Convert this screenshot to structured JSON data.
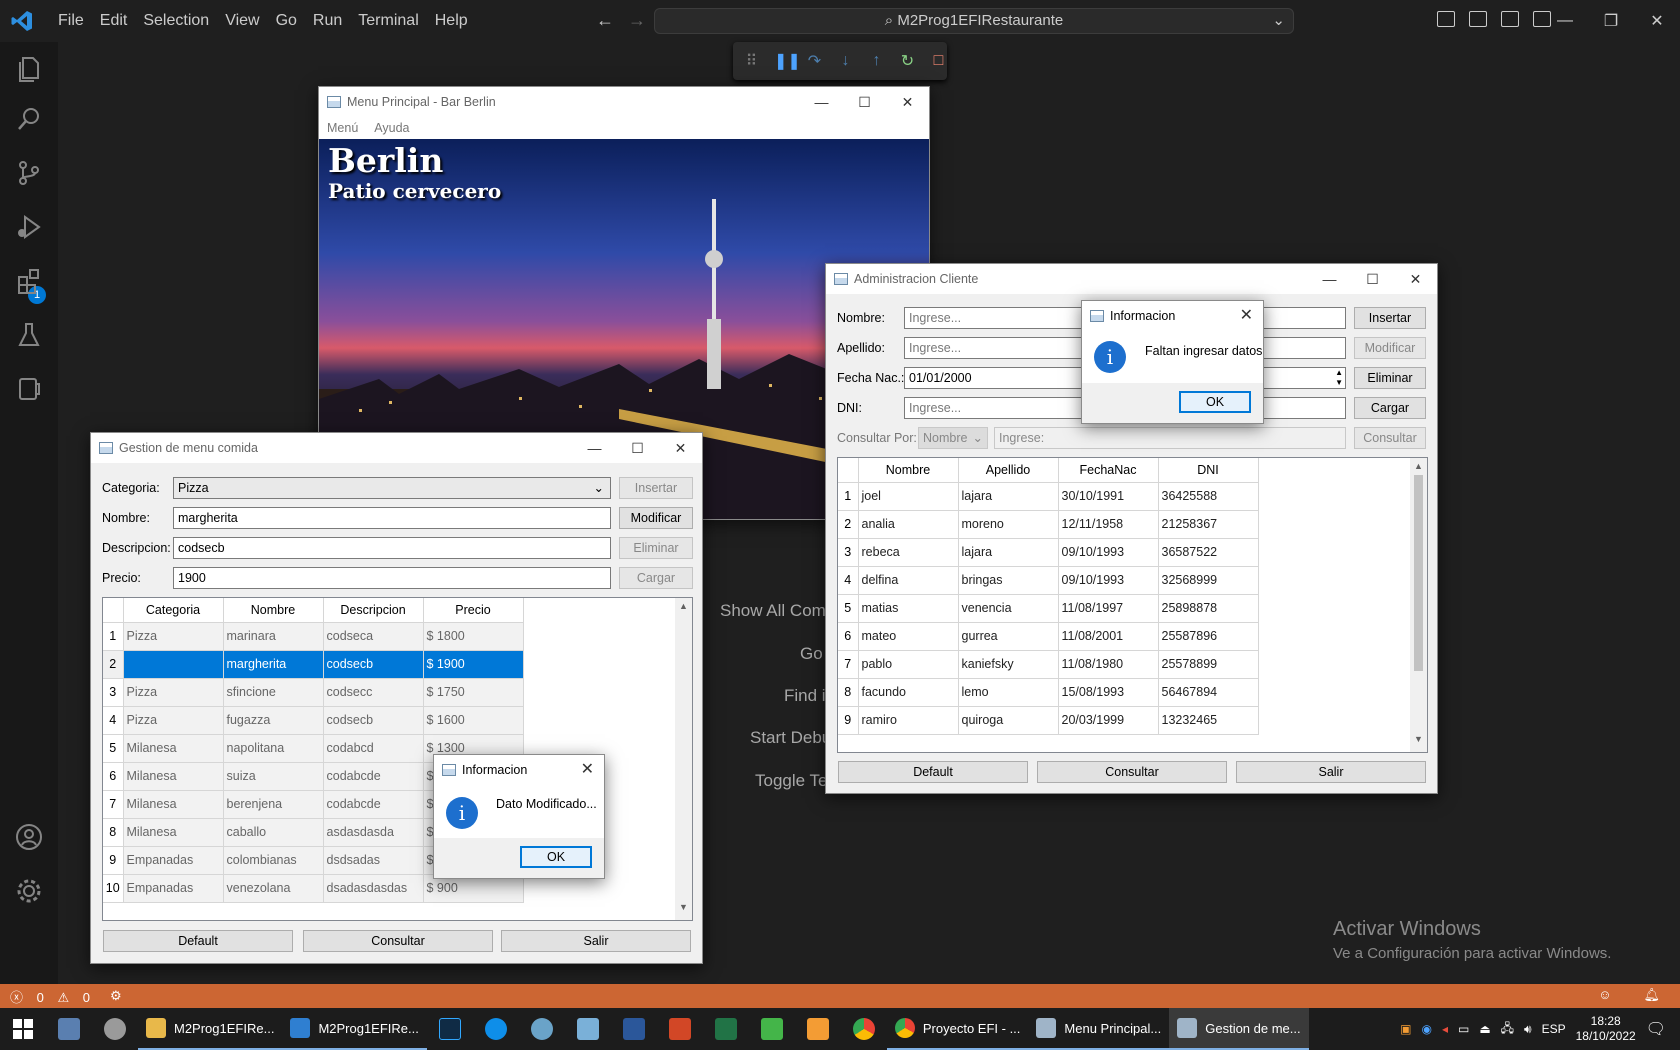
{
  "vscode": {
    "menu": [
      "File",
      "Edit",
      "Selection",
      "View",
      "Go",
      "Run",
      "Terminal",
      "Help"
    ],
    "command_center": "M2Prog1EFIRestaurante",
    "debug_badge": "1",
    "welcome_hints": [
      "Show All Com",
      "Go",
      "Find i",
      "Start Debu",
      "Toggle Te"
    ],
    "activate_title": "Activar Windows",
    "activate_sub": "Ve a Configuración para activar Windows.",
    "status_errors": "0",
    "status_warnings": "0"
  },
  "menu_principal": {
    "title": "Menu Principal - Bar Berlin",
    "menu_items": [
      "Menú",
      "Ayuda"
    ],
    "banner_title": "Berlin",
    "banner_subtitle": "Patio cervecero"
  },
  "gestion_menu": {
    "title": "Gestion de menu comida",
    "labels": {
      "categoria": "Categoria:",
      "nombre": "Nombre:",
      "descripcion": "Descripcion:",
      "precio": "Precio:"
    },
    "values": {
      "categoria": "Pizza",
      "nombre": "margherita",
      "descripcion": "codsecb",
      "precio": "1900"
    },
    "buttons": {
      "insertar": "Insertar",
      "modificar": "Modificar",
      "eliminar": "Eliminar",
      "cargar": "Cargar",
      "default": "Default",
      "consultar": "Consultar",
      "salir": "Salir"
    },
    "columns": [
      "Categoria",
      "Nombre",
      "Descripcion",
      "Precio"
    ],
    "rows": [
      {
        "n": "1",
        "cat": "Pizza",
        "nom": "marinara",
        "desc": "codseca",
        "precio": "$ 1800"
      },
      {
        "n": "2",
        "cat": "",
        "nom": "margherita",
        "desc": "codsecb",
        "precio": "$ 1900"
      },
      {
        "n": "3",
        "cat": "Pizza",
        "nom": "sfincione",
        "desc": "codsecc",
        "precio": "$ 1750"
      },
      {
        "n": "4",
        "cat": "Pizza",
        "nom": "fugazza",
        "desc": "codsecb",
        "precio": "$ 1600"
      },
      {
        "n": "5",
        "cat": "Milanesa",
        "nom": "napolitana",
        "desc": "codabcd",
        "precio": "$ 1300"
      },
      {
        "n": "6",
        "cat": "Milanesa",
        "nom": "suiza",
        "desc": "codabcde",
        "precio": "$"
      },
      {
        "n": "7",
        "cat": "Milanesa",
        "nom": "berenjena",
        "desc": "codabcde",
        "precio": "$"
      },
      {
        "n": "8",
        "cat": "Milanesa",
        "nom": "caballo",
        "desc": "asdasdasda",
        "precio": "$"
      },
      {
        "n": "9",
        "cat": "Empanadas",
        "nom": "colombianas",
        "desc": "dsdsadas",
        "precio": "$"
      },
      {
        "n": "10",
        "cat": "Empanadas",
        "nom": "venezolana",
        "desc": "dsadasdasdas",
        "precio": "$ 900"
      }
    ],
    "dialog": {
      "title": "Informacion",
      "message": "Dato Modificado...",
      "ok": "OK"
    }
  },
  "admin_cliente": {
    "title": "Administracion Cliente",
    "labels": {
      "nombre": "Nombre:",
      "apellido": "Apellido:",
      "fecha": "Fecha Nac.:",
      "dni": "DNI:",
      "consultar_por": "Consultar Por:"
    },
    "placeholders": {
      "nombre": "Ingrese...",
      "apellido": "Ingrese...",
      "dni": "Ingrese...",
      "consulta": "Ingrese:"
    },
    "fecha_value": "01/01/2000",
    "consultar_por_value": "Nombre",
    "buttons": {
      "insertar": "Insertar",
      "modificar": "Modificar",
      "eliminar": "Eliminar",
      "cargar": "Cargar",
      "consultar_top": "Consultar",
      "default": "Default",
      "consultar": "Consultar",
      "salir": "Salir"
    },
    "columns": [
      "Nombre",
      "Apellido",
      "FechaNac",
      "DNI"
    ],
    "rows": [
      {
        "n": "1",
        "nom": "joel",
        "ape": "lajara",
        "fecha": "30/10/1991",
        "dni": "36425588"
      },
      {
        "n": "2",
        "nom": "analia",
        "ape": "moreno",
        "fecha": "12/11/1958",
        "dni": "21258367"
      },
      {
        "n": "3",
        "nom": "rebeca",
        "ape": "lajara",
        "fecha": "09/10/1993",
        "dni": "36587522"
      },
      {
        "n": "4",
        "nom": "delfina",
        "ape": "bringas",
        "fecha": "09/10/1993",
        "dni": "32568999"
      },
      {
        "n": "5",
        "nom": "matias",
        "ape": "venencia",
        "fecha": "11/08/1997",
        "dni": "25898878"
      },
      {
        "n": "6",
        "nom": "mateo",
        "ape": "gurrea",
        "fecha": "11/08/2001",
        "dni": "25587896"
      },
      {
        "n": "7",
        "nom": "pablo",
        "ape": "kaniefsky",
        "fecha": "11/08/1980",
        "dni": "25578899"
      },
      {
        "n": "8",
        "nom": "facundo",
        "ape": "lemo",
        "fecha": "15/08/1993",
        "dni": "56467894"
      },
      {
        "n": "9",
        "nom": "ramiro",
        "ape": "quiroga",
        "fecha": "20/03/1999",
        "dni": "13232465"
      }
    ],
    "dialog": {
      "title": "Informacion",
      "message": "Faltan ingresar datos",
      "ok": "OK"
    }
  },
  "taskbar": {
    "apps": [
      {
        "label": "M2Prog1EFIRe...",
        "color": "#e8b84a"
      },
      {
        "label": "M2Prog1EFIRe...",
        "color": "#2f7fd1"
      },
      {
        "label": "Proyecto EFI - ...",
        "color": "#dd4b39"
      },
      {
        "label": "Menu Principal...",
        "color": "#9fb4c8"
      },
      {
        "label": "Gestion de me...",
        "color": "#9fb4c8"
      }
    ],
    "lang": "ESP",
    "time": "18:28",
    "date": "18/10/2022"
  }
}
